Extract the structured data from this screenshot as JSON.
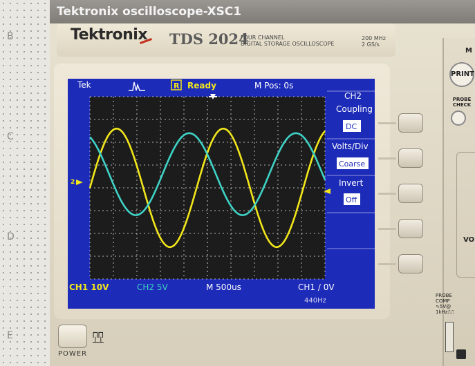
{
  "window": {
    "title": "Tektronix oscilloscope-XSC1"
  },
  "background": {
    "letters": [
      "B",
      "C",
      "D",
      "E"
    ]
  },
  "instrument": {
    "brand": "Tektronix",
    "model": "TDS 2024",
    "description_line1": "FOUR CHANNEL",
    "description_line2": "DIGITAL STORAGE OSCILLOSCOPE",
    "spec_line1": "200 MHz",
    "spec_line2": "2 GS/s",
    "power_label": "POWER"
  },
  "screen": {
    "brand_short": "Tek",
    "trigger_state": "R",
    "status": "Ready",
    "m_pos": "M Pos: 0s",
    "channel_marker": "2",
    "ch1_scale": "CH1  10V",
    "ch2_scale": "CH2  5V",
    "timebase": "M 500us",
    "trigger_readout": "CH1 ∕ 0V",
    "frequency": "440Hz",
    "colors": {
      "screen_bg": "#1c2bb8",
      "grid": "#b8b8b8",
      "ch1": "#f2e61b",
      "ch2": "#3fd2c6",
      "text": "#ffffff"
    }
  },
  "side_menu": {
    "title": "CH2",
    "items": [
      {
        "label": "Coupling",
        "value": "DC"
      },
      {
        "label": "Volts/Div",
        "value": "Coarse"
      },
      {
        "label": "Invert",
        "value": "Off"
      }
    ]
  },
  "right_panel": {
    "m_label": "M",
    "print_label": "PRINT",
    "probe_check_label": "PROBE CHECK",
    "vo_label": "VO",
    "probe_comp_label": "PROBE COMP ∿5V@ 1kHz⎍⎍"
  },
  "chart_data": {
    "type": "line",
    "x": [
      0,
      0.5,
      1.0,
      1.5,
      2.0,
      2.5,
      3.0,
      3.5,
      4.0,
      4.5,
      5.0
    ],
    "series": [
      {
        "name": "CH1",
        "amplitude_div": 2.6,
        "period_ms": 2.27,
        "phase_deg": 0,
        "offset_div": 0
      },
      {
        "name": "CH2",
        "amplitude_div": 1.8,
        "period_ms": 2.27,
        "phase_deg": 115,
        "offset_div": 0.6
      }
    ],
    "xlim_ms": [
      0,
      5
    ],
    "divisions_x": 10,
    "divisions_y": 8,
    "grid": true
  }
}
